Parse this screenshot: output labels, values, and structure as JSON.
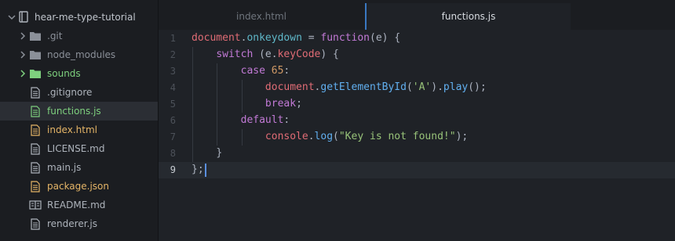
{
  "project": {
    "name": "hear-me-type-tutorial"
  },
  "tree": [
    {
      "name": ".git",
      "type": "folder",
      "color": "#8b9099"
    },
    {
      "name": "node_modules",
      "type": "folder",
      "color": "#8b9099"
    },
    {
      "name": "sounds",
      "type": "folder",
      "color": "#7ed07e"
    },
    {
      "name": ".gitignore",
      "type": "file",
      "color": "#aeb4bc"
    },
    {
      "name": "functions.js",
      "type": "file",
      "color": "#7ed07e"
    },
    {
      "name": "index.html",
      "type": "file",
      "color": "#e5b567"
    },
    {
      "name": "LICENSE.md",
      "type": "file",
      "color": "#aeb4bc"
    },
    {
      "name": "main.js",
      "type": "file",
      "color": "#aeb4bc"
    },
    {
      "name": "package.json",
      "type": "file",
      "color": "#e5b567"
    },
    {
      "name": "README.md",
      "type": "book",
      "color": "#aeb4bc"
    },
    {
      "name": "renderer.js",
      "type": "file",
      "color": "#aeb4bc"
    }
  ],
  "selected_file": "functions.js",
  "tabs": [
    {
      "label": "index.html",
      "active": false
    },
    {
      "label": "functions.js",
      "active": true
    }
  ],
  "editor": {
    "line_numbers": [
      "1",
      "2",
      "3",
      "4",
      "5",
      "6",
      "7",
      "8",
      "9"
    ],
    "current_line": 9,
    "code": [
      [
        [
          "document",
          "v"
        ],
        [
          ".",
          "p"
        ],
        [
          "onkeydown",
          "o"
        ],
        [
          " = ",
          "p"
        ],
        [
          "function",
          "k"
        ],
        [
          "(e) {",
          "p"
        ]
      ],
      [
        [
          "    ",
          "p"
        ],
        [
          "switch",
          "k"
        ],
        [
          " (e.",
          "p"
        ],
        [
          "keyCode",
          "v"
        ],
        [
          ") {",
          "p"
        ]
      ],
      [
        [
          "        ",
          "p"
        ],
        [
          "case",
          "k"
        ],
        [
          " ",
          "p"
        ],
        [
          "65",
          "n"
        ],
        [
          ":",
          "p"
        ]
      ],
      [
        [
          "            ",
          "p"
        ],
        [
          "document",
          "v"
        ],
        [
          ".",
          "p"
        ],
        [
          "getElementById",
          "m"
        ],
        [
          "(",
          "p"
        ],
        [
          "'A'",
          "s"
        ],
        [
          ").",
          "p"
        ],
        [
          "play",
          "m"
        ],
        [
          "();",
          "p"
        ]
      ],
      [
        [
          "            ",
          "p"
        ],
        [
          "break",
          "k"
        ],
        [
          ";",
          "p"
        ]
      ],
      [
        [
          "        ",
          "p"
        ],
        [
          "default",
          "k"
        ],
        [
          ":",
          "p"
        ]
      ],
      [
        [
          "            ",
          "p"
        ],
        [
          "console",
          "v"
        ],
        [
          ".",
          "p"
        ],
        [
          "log",
          "m"
        ],
        [
          "(",
          "p"
        ],
        [
          "\"Key is not found!\"",
          "s"
        ],
        [
          ");",
          "p"
        ]
      ],
      [
        [
          "    ",
          "p"
        ],
        [
          "}",
          "p"
        ]
      ],
      [
        [
          "};",
          "p"
        ]
      ]
    ]
  },
  "colors": {
    "accent": "#3a78c2",
    "sidebar_bg": "#1b1d21",
    "editor_bg": "#1f2227"
  }
}
